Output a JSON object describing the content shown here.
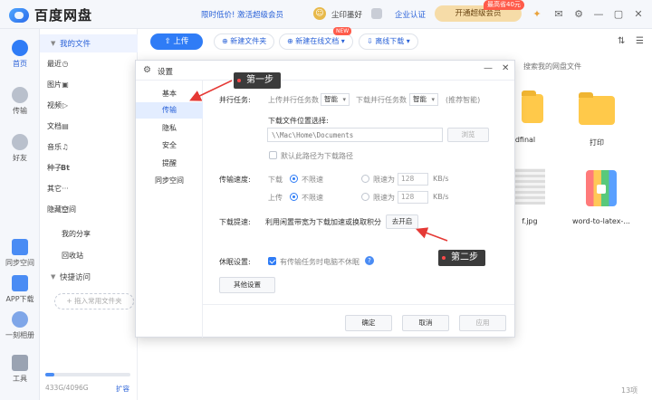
{
  "app": {
    "title": "百度网盘",
    "promo_text": "限时低价!",
    "promo_link": "激活超级会员",
    "username": "尘印墨好",
    "cert_link": "企业认证",
    "open_vip": "开通超级会员",
    "promo_tag": "最高省40元"
  },
  "rail": {
    "items": [
      {
        "label": "首页"
      },
      {
        "label": "传输"
      },
      {
        "label": "好友"
      },
      {
        "label": "同步空间"
      },
      {
        "label": "APP下载"
      },
      {
        "label": "一刻相册"
      },
      {
        "label": "工具"
      }
    ]
  },
  "sidebar": {
    "my_files": "我的文件",
    "items": [
      {
        "icon": "最",
        "label": "最近"
      },
      {
        "icon": "▣",
        "label": "图片"
      },
      {
        "icon": "▷",
        "label": "视频"
      },
      {
        "icon": "▤",
        "label": "文档"
      },
      {
        "icon": "♫",
        "label": "音乐"
      },
      {
        "icon": "Bt",
        "label": "种子"
      },
      {
        "icon": "···",
        "label": "其它"
      },
      {
        "icon": "▢",
        "label": "隐藏空间"
      }
    ],
    "my_share": "我的分享",
    "recycle": "回收站",
    "quick_access": "快捷访问",
    "add_quick": "+ 拖入常用文件夹",
    "storage_text": "433G/4096G",
    "storage_expand": "扩容",
    "storage_fraction": 0.106
  },
  "toolbar": {
    "upload": "上传",
    "new_folder": "新建文件夹",
    "new_online_doc": "新建在线文档",
    "new_tag": "NEW",
    "offline_download": "离线下载",
    "search_placeholder": "搜索我的网盘文件"
  },
  "files": [
    {
      "name": "dfinal"
    },
    {
      "name": "打印"
    },
    {
      "name": "f.jpg"
    },
    {
      "name": "word-to-latex-..."
    }
  ],
  "item_count": "13项",
  "dialog": {
    "title": "设置",
    "nav": [
      "基本",
      "传输",
      "隐私",
      "安全",
      "提醒",
      "同步空间"
    ],
    "parallel_label": "并行任务:",
    "upload_parallel": "上传并行任务数",
    "upload_parallel_value": "智能",
    "download_parallel": "下载并行任务数",
    "download_parallel_value": "智能",
    "recommend": "(推荐智能)",
    "download_location_label": "下载文件位置选择:",
    "download_path": "\\\\Mac\\Home\\Documents",
    "browse": "浏览",
    "default_path_label": "默认此路径为下载路径",
    "speed_label": "传输速度:",
    "download_word": "下载",
    "upload_word": "上传",
    "no_limit": "不限速",
    "limit_to": "限速为",
    "limit_value_download": "128",
    "limit_value_upload": "128",
    "unit": "KB/s",
    "accelerate_label": "下载提速:",
    "accelerate_desc": "利用闲置带宽为下载加速或换取积分",
    "accelerate_btn": "去开启",
    "sleep_label": "休眠设置:",
    "sleep_desc": "有传输任务时电脑不休眠",
    "other_settings": "其他设置",
    "ok": "确定",
    "cancel": "取消",
    "apply": "应用"
  },
  "annotations": {
    "step1": "第一步",
    "step2": "第二步"
  },
  "colors": {
    "accent": "#2f7cf6",
    "annotation_arrow": "#e53935",
    "annotation_box": "#3b3b3b"
  }
}
